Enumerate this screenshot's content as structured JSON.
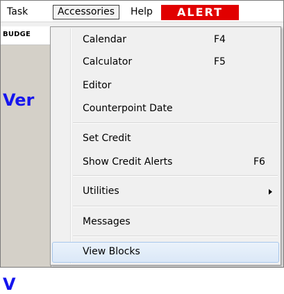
{
  "menubar": {
    "task": "Task",
    "accessories": "Accessories",
    "help": "Help",
    "alert": "ALERT"
  },
  "background": {
    "header": "BUDGE",
    "big_text_1": "Ver",
    "big_text_2": "V"
  },
  "dropdown": {
    "calendar": {
      "label": "Calendar",
      "shortcut": "F4"
    },
    "calculator": {
      "label": "Calculator",
      "shortcut": "F5"
    },
    "editor": {
      "label": "Editor"
    },
    "counterpoint_date": {
      "label": "Counterpoint Date"
    },
    "set_credit": {
      "label": "Set Credit"
    },
    "show_credit_alerts": {
      "label": "Show Credit Alerts",
      "shortcut": "F6"
    },
    "utilities": {
      "label": "Utilities"
    },
    "messages": {
      "label": "Messages"
    },
    "view_blocks": {
      "label": "View Blocks"
    }
  },
  "colors": {
    "alert_bg": "#e10000",
    "accent_blue": "#1515ee",
    "hover_border": "#a8c7ec"
  }
}
